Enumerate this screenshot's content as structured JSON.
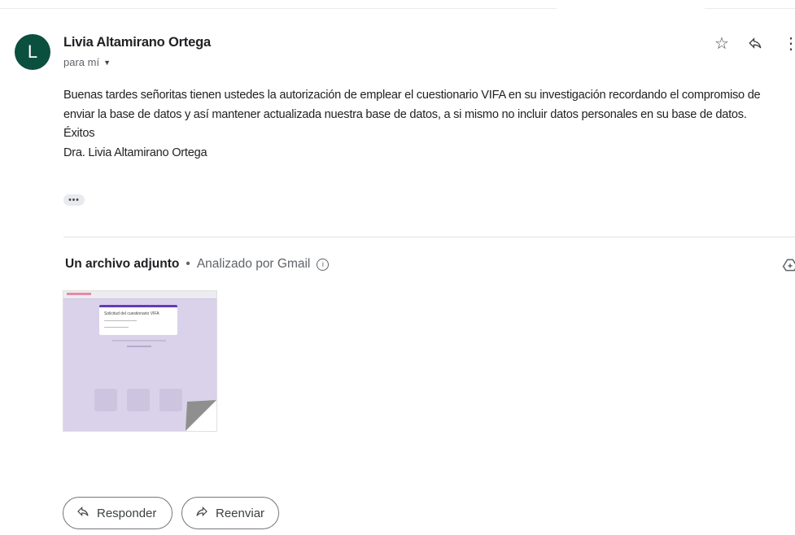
{
  "message": {
    "avatar_letter": "L",
    "avatar_color": "#0b4f3f",
    "sender": "Livia Altamirano Ortega",
    "recipient_label": "para mí",
    "body_lines": [
      "Buenas tardes señoritas tienen ustedes la autorización de emplear el cuestionario VIFA en su investigación recordando el compromiso de enviar la base de datos y así mantener actualizada nuestra base de datos, a si mismo no incluir datos personales en su base de datos.",
      "Éxitos",
      "Dra. Livia Altamirano Ortega"
    ],
    "icons": {
      "star": "star-icon",
      "reply": "reply-icon",
      "more": "more-vert-icon",
      "ellipsis": "show-trimmed-content-icon"
    }
  },
  "attachments": {
    "title": "Un archivo adjunto",
    "separator": "•",
    "scanned_label": "Analizado por Gmail",
    "info_icon": "info-icon",
    "drive_icon": "add-to-drive-icon",
    "thumbnail_title": "Solicitud del cuestionario VIFA"
  },
  "actions": {
    "reply_label": "Responder",
    "forward_label": "Reenviar"
  }
}
